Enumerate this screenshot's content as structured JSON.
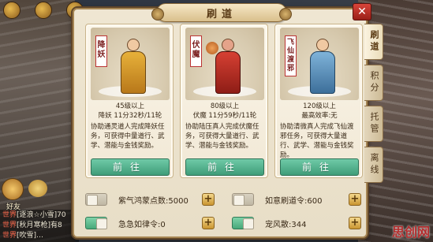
{
  "background": {
    "friend_label": "好友",
    "chat_lines": [
      {
        "channel": "世界",
        "text": "[逐浪☆小雪]70"
      },
      {
        "channel": "世界",
        "text": "[秋月寒枪]有8"
      },
      {
        "channel": "世界",
        "text": "[吹雪]…"
      }
    ]
  },
  "window": {
    "title": "刷道",
    "close_label": "✕"
  },
  "cards": [
    {
      "tag": "降妖",
      "level": "45级以上",
      "timing": "降妖 11分32秒/11轮",
      "desc": "协助通灵道人完成降妖任务，可获得中量道行、武学、潜能与金钱奖励。",
      "button": "前往"
    },
    {
      "tag": "伏魔",
      "level": "80级以上",
      "timing": "伏魔 11分59秒/11轮",
      "desc": "协助陆压真人完成伏魔任务，可获得大量道行、武学、潜能与金钱奖励。",
      "button": "前往"
    },
    {
      "tag": "飞仙渡邪",
      "level": "120级以上",
      "timing": "最高效率:无",
      "desc": "协助清微真人完成飞仙渡邪任务，可获得大量道行、武学、潜能与金钱奖励。",
      "button": "前往"
    }
  ],
  "options": [
    {
      "label": "紫气鸿蒙点数:5000",
      "on": false
    },
    {
      "label": "如意刷道令:600",
      "on": false
    },
    {
      "label": "急急如律令:0",
      "on": true
    },
    {
      "label": "宠风散:344",
      "on": true
    }
  ],
  "plus_label": "+",
  "side_tabs": [
    {
      "label": "刷道",
      "active": true
    },
    {
      "label": "积分",
      "active": false
    },
    {
      "label": "托管",
      "active": false
    },
    {
      "label": "离线",
      "active": false
    }
  ],
  "watermark": "思创网"
}
